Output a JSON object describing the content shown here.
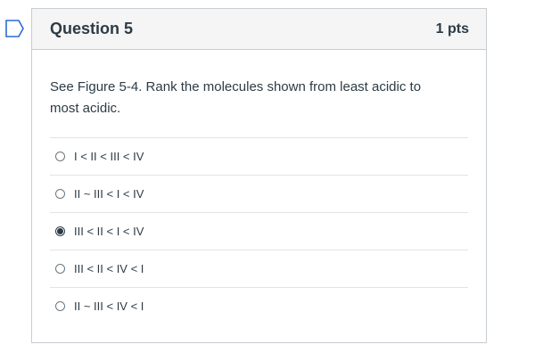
{
  "question": {
    "title": "Question 5",
    "points": "1 pts",
    "text": "See Figure 5-4. Rank the molecules shown from least acidic to most acidic."
  },
  "answers": [
    {
      "label": "I < II < III < IV",
      "selected": false
    },
    {
      "label": "II ~ III < I < IV",
      "selected": false
    },
    {
      "label": "III < II < I < IV",
      "selected": true
    },
    {
      "label": "III < II < IV < I",
      "selected": false
    },
    {
      "label": "II ~ III < IV < I",
      "selected": false
    }
  ],
  "colors": {
    "flag_outline": "#2d6ad7",
    "header_background": "#f5f5f5",
    "border": "#c7cdd1",
    "text": "#2d3b45"
  },
  "icons": {
    "flag": "bookmark-flag-icon"
  }
}
